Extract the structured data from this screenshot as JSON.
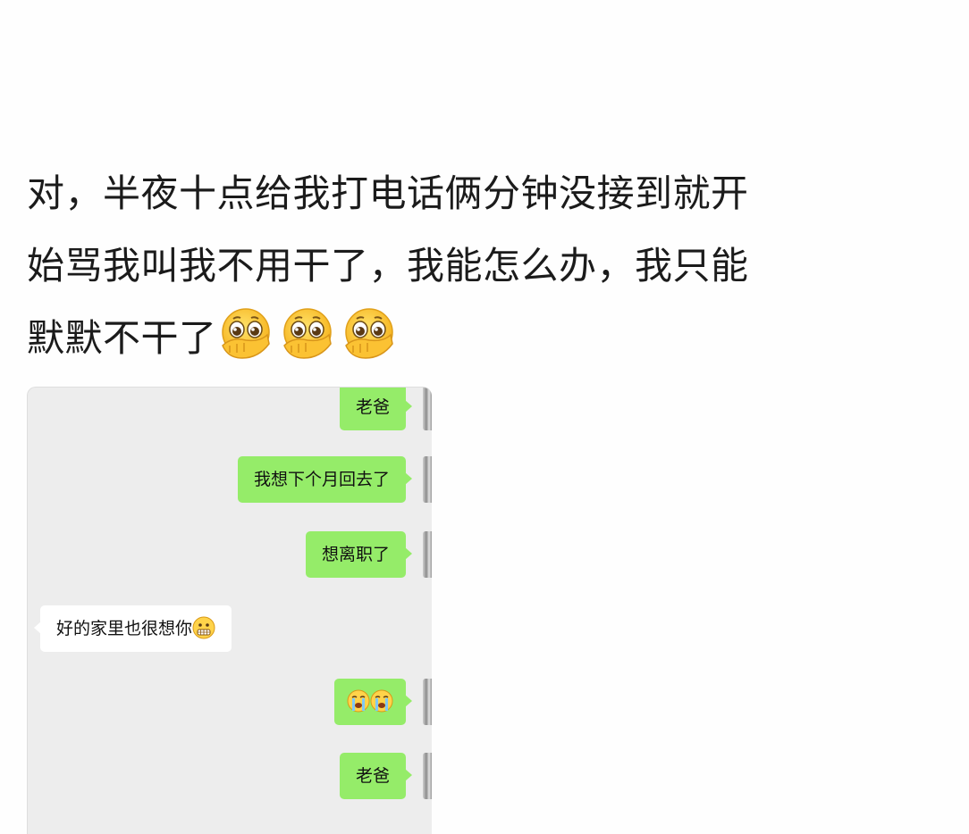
{
  "post": {
    "line1": "对，半夜十点给我打电话俩分钟没接到就开",
    "line2": "始骂我叫我不用干了，我能怎么办，我只能",
    "line3": "默默不干了",
    "trailing_emoji": "pleading-hand-over-mouth-emoji"
  },
  "chat": {
    "messages": [
      {
        "sender": "me",
        "text": "老爸"
      },
      {
        "sender": "me",
        "text": "我想下个月回去了"
      },
      {
        "sender": "me",
        "text": "想离职了"
      },
      {
        "sender": "other",
        "text": "好的家里也很想你",
        "emoji": "grimacing-emoji"
      },
      {
        "sender": "me",
        "text": "",
        "emoji": "crying-emoji"
      },
      {
        "sender": "me",
        "text": "老爸"
      }
    ]
  },
  "colors": {
    "my_bubble": "#95ec69",
    "other_bubble": "#ffffff",
    "chat_background": "#ededed"
  }
}
